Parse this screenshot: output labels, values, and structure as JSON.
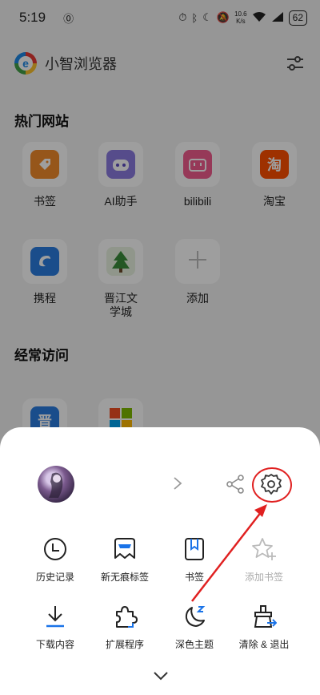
{
  "status_bar": {
    "time": "5:19",
    "network_speed_value": "10.6",
    "network_speed_unit": "K/s",
    "battery": "62"
  },
  "app": {
    "title": "小智浏览器"
  },
  "hot_sites": {
    "title": "热门网站",
    "items": [
      {
        "label": "书签",
        "icon": "bookmark-tag-icon",
        "color": "#f28b2a"
      },
      {
        "label": "AI助手",
        "icon": "robot-icon",
        "color": "#8c7be0"
      },
      {
        "label": "bilibili",
        "icon": "bilibili-icon",
        "color": "#f25d8e"
      },
      {
        "label": "淘宝",
        "icon": "taobao-icon",
        "color": "#ff5000",
        "glyph": "淘"
      },
      {
        "label": "携程",
        "icon": "ctrip-icon",
        "color": "#2a7de1"
      },
      {
        "label": "晋江文学城",
        "icon": "jjwxc-icon",
        "color": "#3b8d3a"
      },
      {
        "label": "添加",
        "icon": "plus-icon",
        "color": "#bbbbbb"
      }
    ]
  },
  "frequent": {
    "title": "经常访问",
    "items": [
      {
        "icon": "jin-icon",
        "glyph": "晋",
        "color": "#2a7de1"
      },
      {
        "icon": "microsoft-icon"
      }
    ]
  },
  "menu": {
    "row1": [
      {
        "label": "历史记录",
        "icon": "clock-icon",
        "enabled": true
      },
      {
        "label": "新无痕标签",
        "icon": "incognito-mask-icon",
        "enabled": true
      },
      {
        "label": "书签",
        "icon": "bookmark-icon",
        "enabled": true
      },
      {
        "label": "添加书签",
        "icon": "star-plus-icon",
        "enabled": false
      }
    ],
    "row2": [
      {
        "label": "下载内容",
        "icon": "download-icon",
        "enabled": true
      },
      {
        "label": "扩展程序",
        "icon": "puzzle-icon",
        "enabled": true
      },
      {
        "label": "深色主题",
        "icon": "moon-icon",
        "enabled": true
      },
      {
        "label": "清除 & 退出",
        "icon": "broom-exit-icon",
        "enabled": true
      }
    ]
  },
  "colors": {
    "accent": "#1a73e8",
    "annotation": "#e02020",
    "sheet_bg": "#ffffff"
  }
}
